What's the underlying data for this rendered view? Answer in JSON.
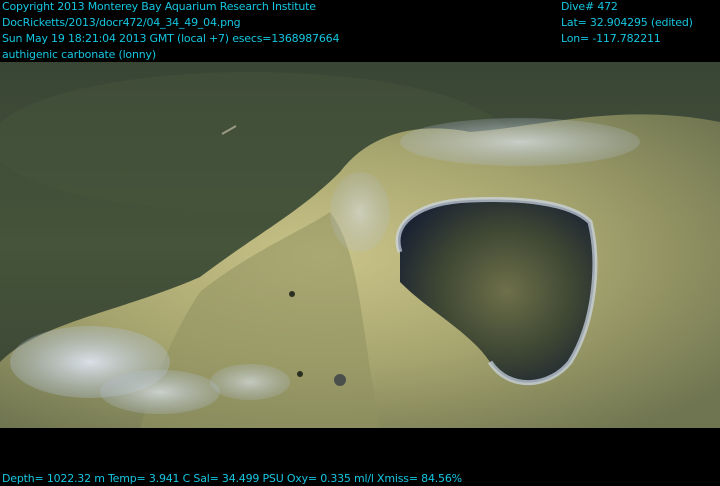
{
  "overlay": {
    "copyright": "Copyright 2013 Monterey Bay Aquarium Research Institute",
    "file_path": "DocRicketts/2013/docr472/04_34_49_04.png",
    "timestamp": "Sun May 19 18:21:04 2013 GMT (local +7)  esecs=1368987664",
    "annotation": "authigenic carbonate (lonny)",
    "dive": "Dive# 472",
    "latitude": "Lat= 32.904295 (edited)",
    "longitude": "Lon= -117.782211",
    "sensors": "Depth= 1022.32 m  Temp= 3.941 C  Sal= 34.499 PSU  Oxy= 0.335 ml/l  Xmiss= 84.56%"
  },
  "colors": {
    "overlay_text": "#15c6e0",
    "sediment": "#3f4d37",
    "rock": "#b4b07a",
    "bacterial_mat": "#c9d4e4"
  }
}
